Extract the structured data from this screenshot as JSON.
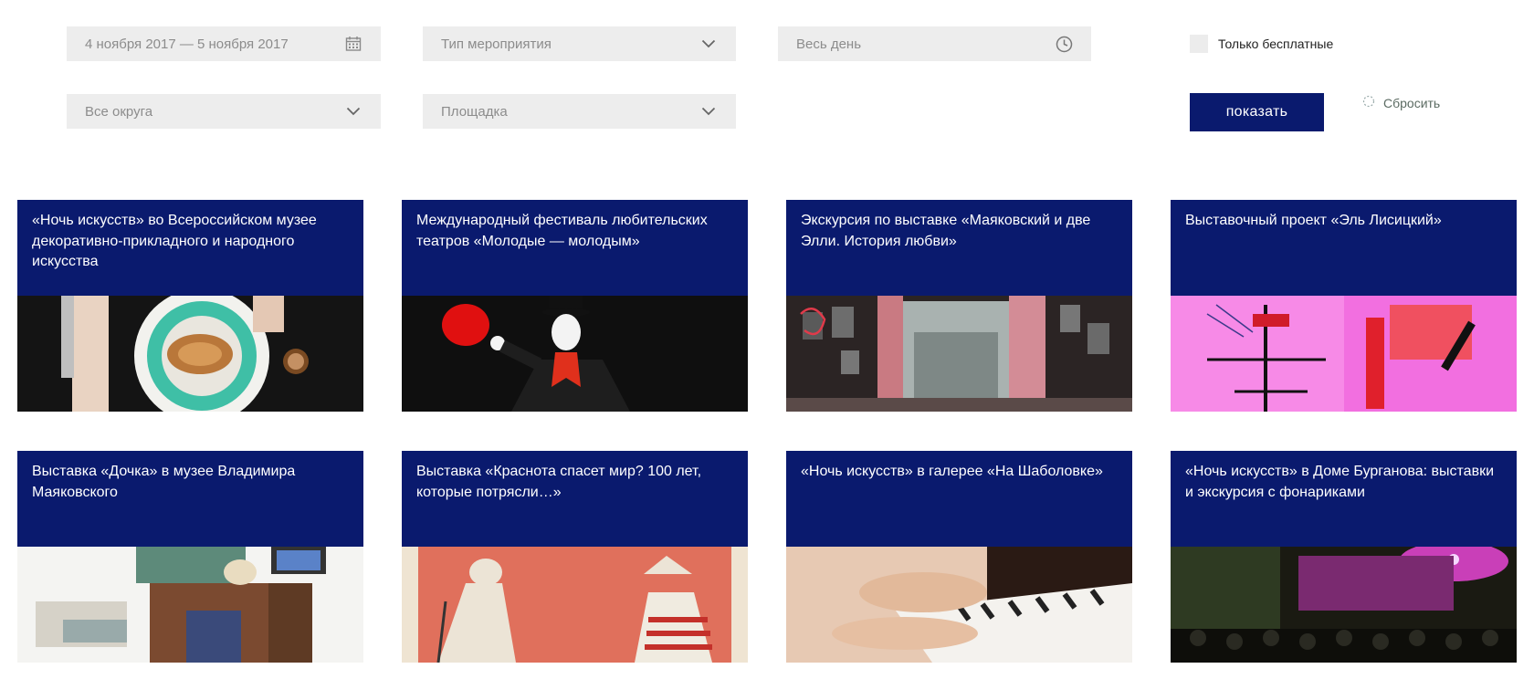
{
  "filters": {
    "date_range": {
      "value": "4 ноября 2017 — 5 ноября 2017",
      "icon": "calendar-icon"
    },
    "event_type": {
      "placeholder": "Тип мероприятия",
      "icon": "chevron-down-icon"
    },
    "time": {
      "value": "Весь день",
      "icon": "clock-icon"
    },
    "district": {
      "placeholder": "Все округа",
      "icon": "chevron-down-icon"
    },
    "venue": {
      "placeholder": "Площадка",
      "icon": "chevron-down-icon"
    },
    "free_only": {
      "label": "Только бесплатные",
      "checked": false
    },
    "show_button": "показать",
    "reset_link": "Сбросить"
  },
  "colors": {
    "accent": "#0a1a6e",
    "field_bg": "#ededed"
  },
  "events": [
    {
      "title": "«Ночь искусств» во Всероссийском музее декоративно-прикладного и народного искусства",
      "image": "plate-with-croissant"
    },
    {
      "title": "Международный фестиваль любительских театров «Молодые — молодым»",
      "image": "mime-with-red-balloon"
    },
    {
      "title": "Экскурсия по выставке «Маяковский и две Элли. История любви»",
      "image": "exhibition-hall"
    },
    {
      "title": "Выставочный проект «Эль Лисицкий»",
      "image": "constructivist-poster"
    },
    {
      "title": "Выставка «Дочка» в музее Владимира Маяковского",
      "image": "room-interior"
    },
    {
      "title": "Выставка «Краснота спасет мир? 100 лет, которые потрясли…»",
      "image": "soviet-poster"
    },
    {
      "title": "«Ночь искусств» в галерее «На Шаболовке»",
      "image": "hands-on-piano"
    },
    {
      "title": "«Ночь искусств» в Доме Бурганова: выставки и экскурсия с фонариками",
      "image": "concert-crowd"
    }
  ]
}
